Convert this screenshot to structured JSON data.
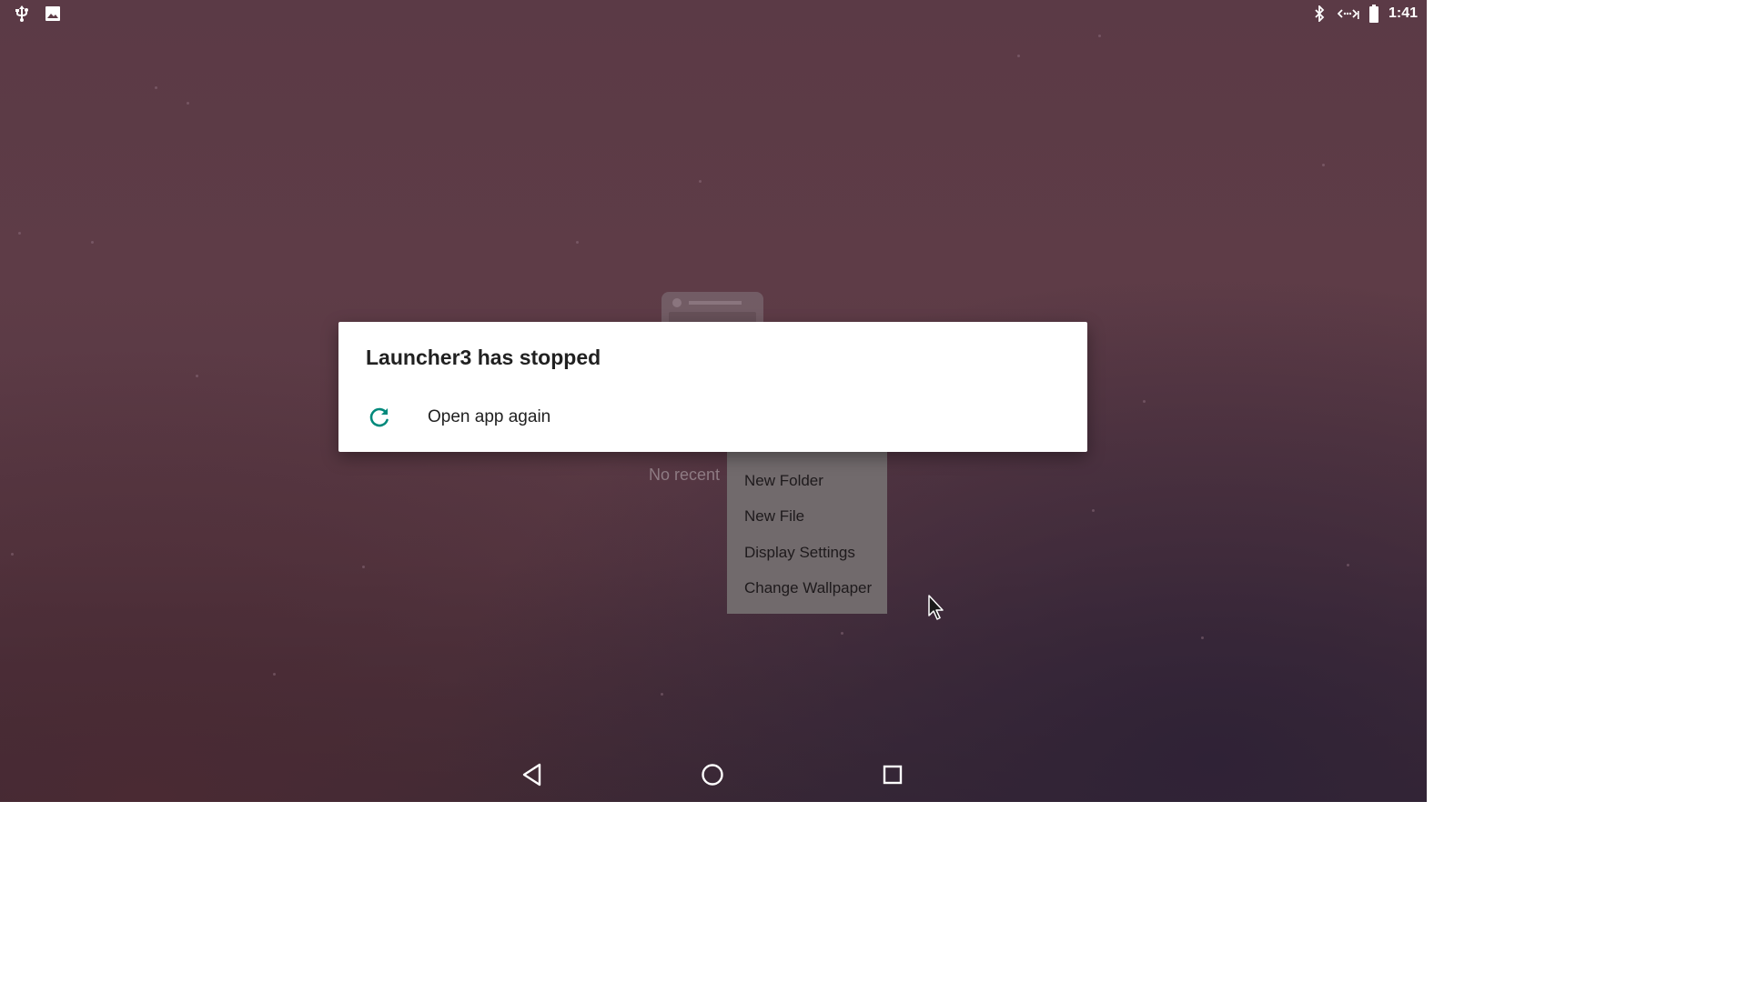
{
  "status_bar": {
    "left_icons": [
      "usb-icon",
      "image-icon"
    ],
    "right_icons": [
      "bluetooth-icon",
      "data-transfer-icon",
      "battery-icon"
    ],
    "time": "1:41"
  },
  "recents": {
    "empty_label": "No recent"
  },
  "context_menu": {
    "items": [
      {
        "label": "New Folder"
      },
      {
        "label": "New File"
      },
      {
        "label": "Display Settings"
      },
      {
        "label": "Change Wallpaper"
      }
    ]
  },
  "dialog": {
    "title": "Launcher3 has stopped",
    "action_label": "Open app again",
    "action_icon": "refresh-icon",
    "accent_color": "#00897b"
  },
  "nav_bar": {
    "buttons": [
      "back-icon",
      "home-icon",
      "recents-icon"
    ]
  },
  "colors": {
    "background": "#5e3c47",
    "menu_background": "#716a6c",
    "dialog_background": "#ffffff"
  }
}
